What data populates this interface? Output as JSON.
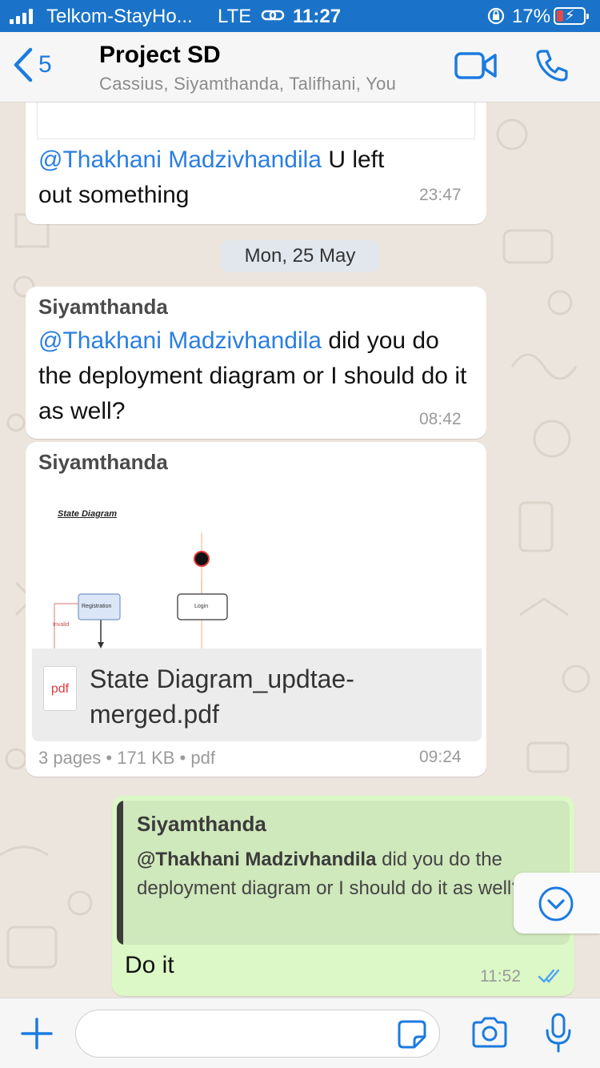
{
  "status_bar": {
    "carrier": "Telkom-StayHo...",
    "network": "LTE",
    "time": "11:27",
    "battery_pct": "17%"
  },
  "header": {
    "back_count": "5",
    "title": "Project SD",
    "subtitle": "Cassius, Siyamthanda, Talifhani, You"
  },
  "messages": {
    "m1": {
      "mention": "@Thakhani Madzivhandila",
      "text": " U left out something",
      "time": "23:47"
    },
    "date_divider": "Mon, 25 May",
    "m2": {
      "sender": "Siyamthanda",
      "mention": "@Thakhani Madzivhandila",
      "text": " did you do the deployment diagram or I should do it as well?",
      "time": "08:42"
    },
    "m3": {
      "sender": "Siyamthanda",
      "preview_title": "State Diagram",
      "preview_registration": "Registration",
      "preview_login": "Login",
      "preview_invalid": "Invalid",
      "pdf_label": "pdf",
      "file_name": "State Diagram_updtae-merged.pdf",
      "pages": "3 pages",
      "size": "171 KB",
      "type": "pdf",
      "time": "09:24"
    },
    "m4": {
      "quoted_sender": "Siyamthanda",
      "quoted_mention": "@Thakhani Madzivhandila",
      "quoted_text": " did you do the deployment diagram or I should do it as well?",
      "text": "Do it",
      "time": "11:52"
    }
  },
  "input": {
    "placeholder": ""
  },
  "colors": {
    "accent": "#1b7be0",
    "status_bar": "#1a73c8",
    "outgoing_bubble": "#dcf8c6",
    "mention": "#2a7ee3"
  }
}
